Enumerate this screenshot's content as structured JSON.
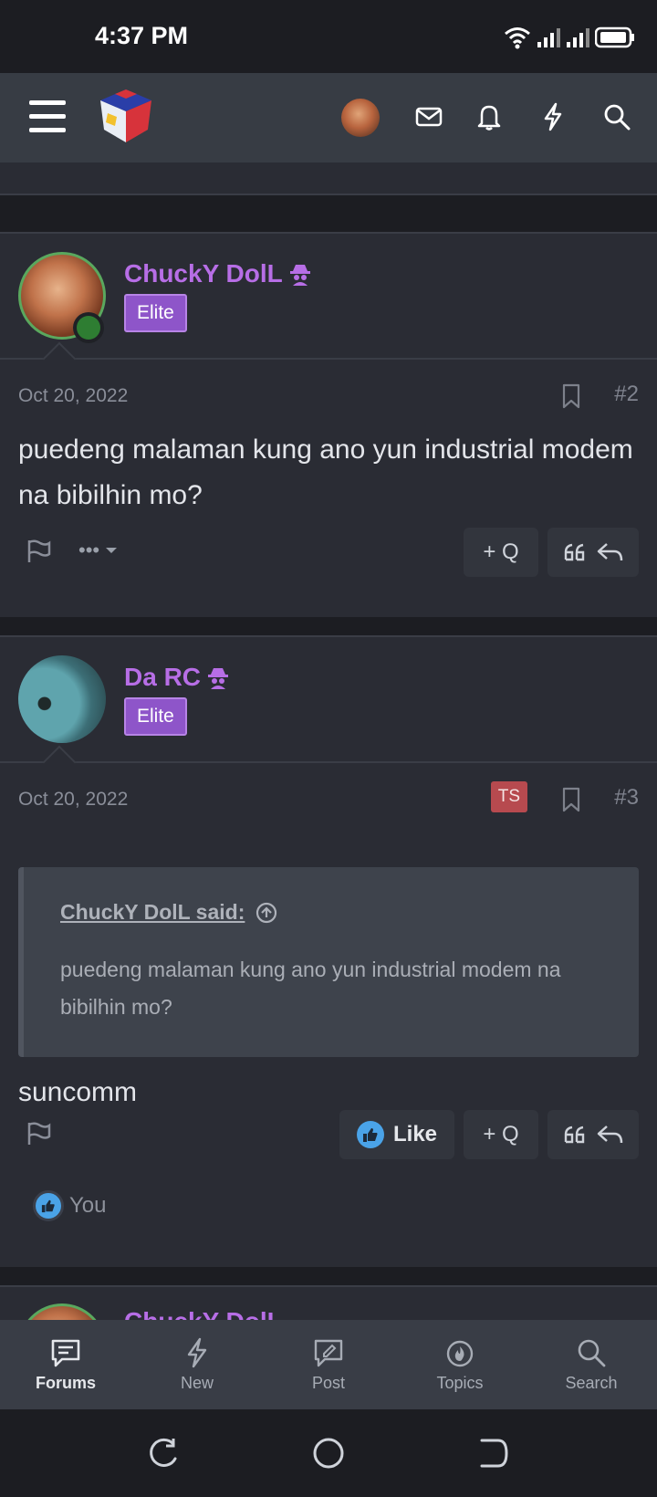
{
  "status": {
    "time": "4:37 PM"
  },
  "nav": {
    "menu_icon": "hamburger-icon",
    "icons": [
      "mail-icon",
      "bell-icon",
      "lightning-icon",
      "search-icon"
    ]
  },
  "posts": [
    {
      "username": "ChuckY DolL",
      "badge": "Elite",
      "date": "Oct 20, 2022",
      "number": "#2",
      "message": "puedeng malaman kung ano yun industrial modem na bibilhin mo?",
      "actions": {
        "more": "•••",
        "quote_label": "+ Q"
      }
    },
    {
      "username": "Da RC",
      "badge": "Elite",
      "ts_badge": "TS",
      "date": "Oct 20, 2022",
      "number": "#3",
      "quote": {
        "author": "ChuckY DolL said:",
        "text": "puedeng malaman kung ano yun industrial modem na bibilhin mo?"
      },
      "message": "suncomm",
      "actions": {
        "like_label": "Like",
        "quote_label": "+ Q"
      },
      "reaction": "You"
    },
    {
      "username": "ChuckY DolL"
    }
  ],
  "tabs": [
    {
      "label": "Forums",
      "icon": "chat-icon",
      "active": true
    },
    {
      "label": "New",
      "icon": "lightning-icon",
      "active": false
    },
    {
      "label": "Post",
      "icon": "edit-icon",
      "active": false
    },
    {
      "label": "Topics",
      "icon": "flame-icon",
      "active": false
    },
    {
      "label": "Search",
      "icon": "search-icon",
      "active": false
    }
  ],
  "colors": {
    "username": "#b76ee6",
    "badge_elite": "#8e55c9",
    "ts_badge": "#b74a4f",
    "like_thumb": "#4aa3e8",
    "online": "#2e7d32"
  }
}
